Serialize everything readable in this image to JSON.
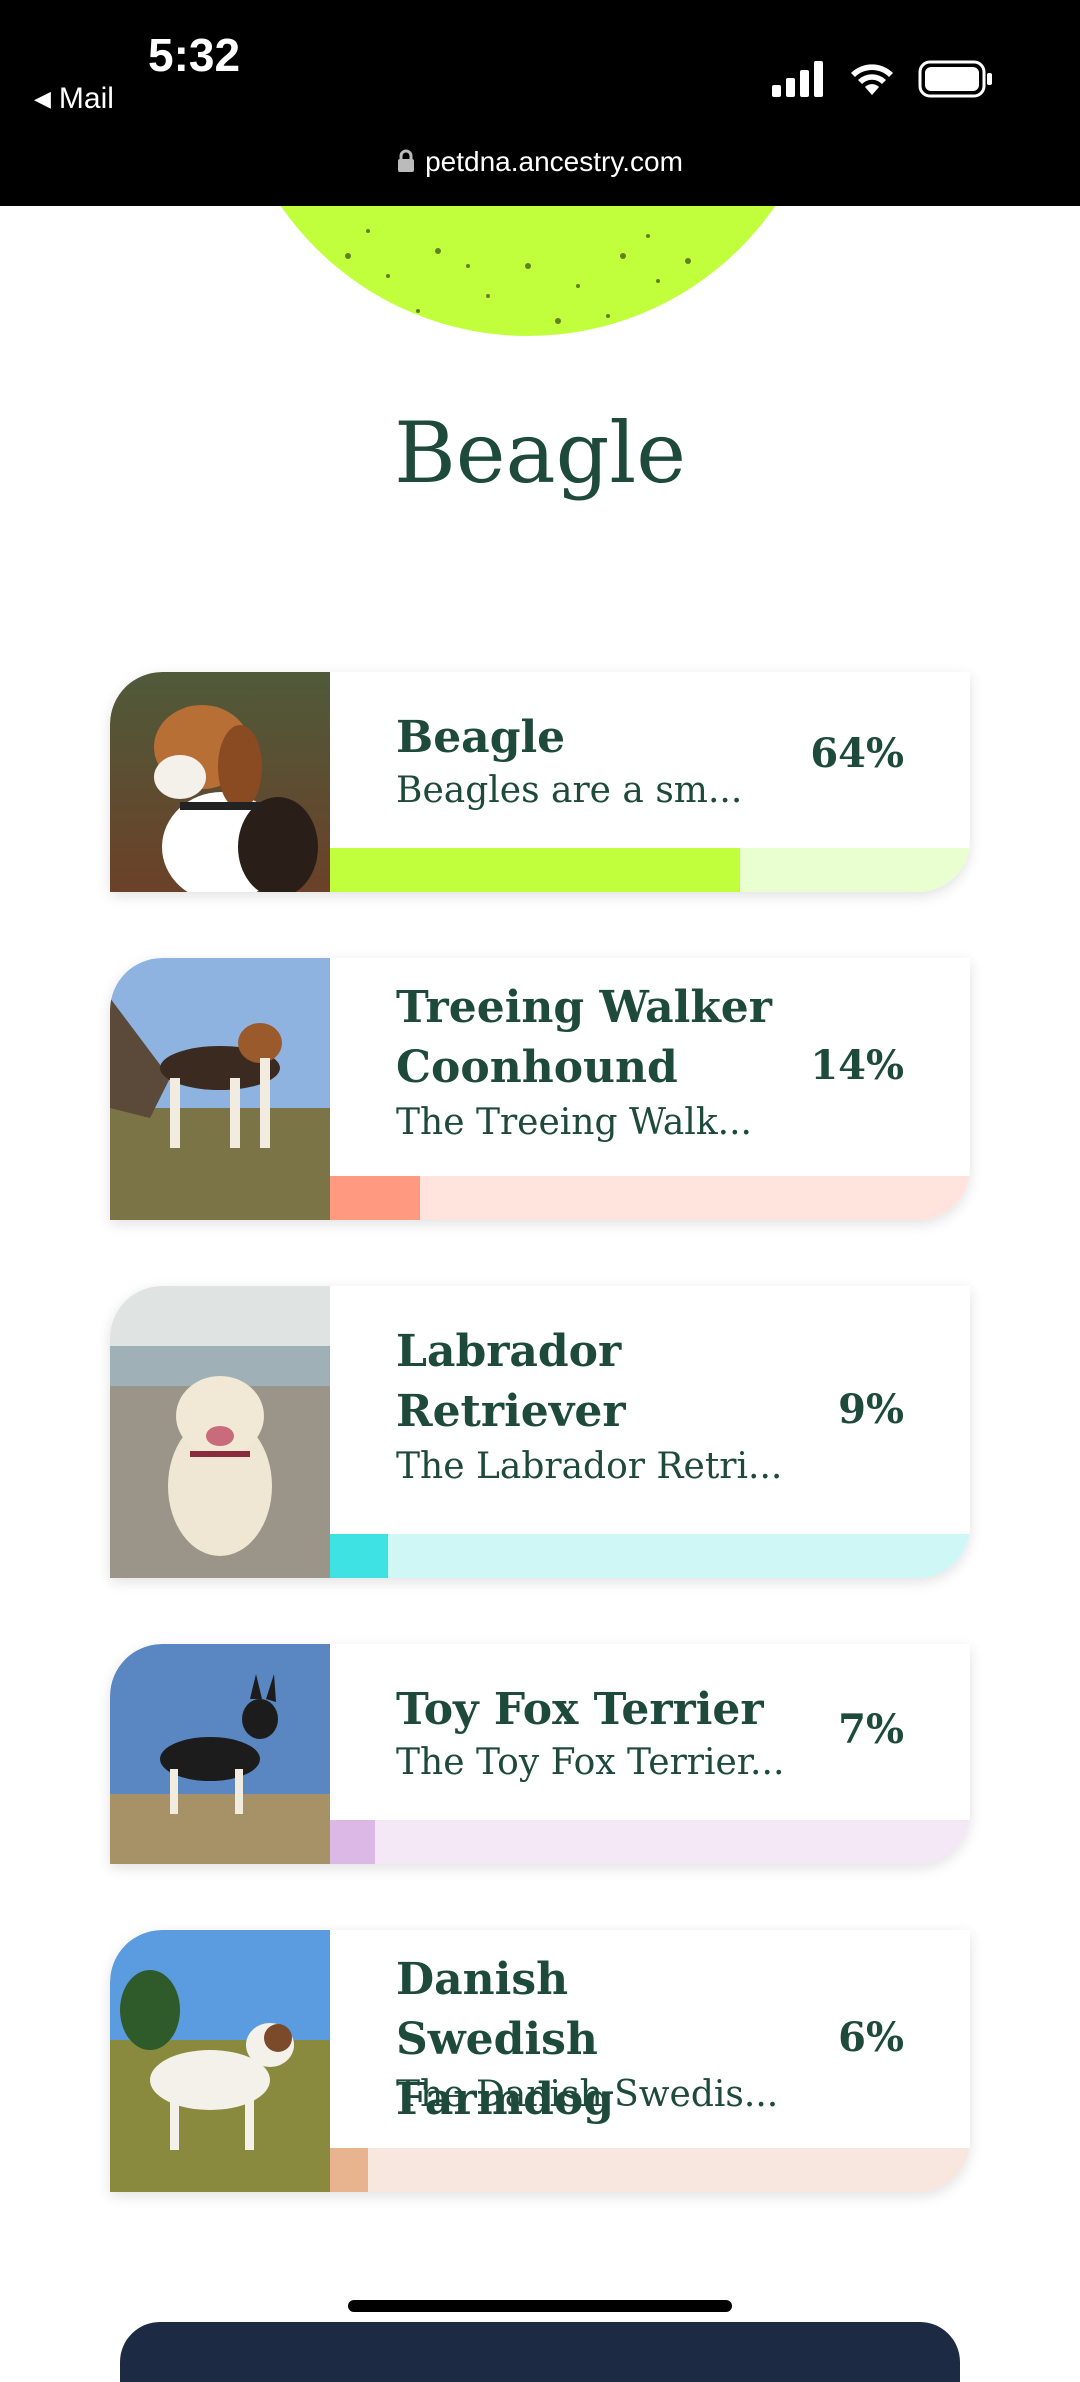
{
  "status_bar": {
    "time": "5:32",
    "back_app": "Mail",
    "url": "petdna.ancestry.com"
  },
  "page": {
    "title": "Beagle",
    "hero_color": "#c1ff3d"
  },
  "breeds": [
    {
      "name": "Beagle",
      "description": "Beagles are a sm...",
      "percent": "64%",
      "bar_fraction": 0.64,
      "bar_color": "#c1ff3d",
      "track_color": "#eaffd0"
    },
    {
      "name": "Treeing Walker Coonhound",
      "description": "The Treeing Walk...",
      "percent": "14%",
      "bar_fraction": 0.14,
      "bar_color": "#ff9a80",
      "track_color": "#ffe3dc"
    },
    {
      "name": "Labrador Retriever",
      "description": "The Labrador Retri...",
      "percent": "9%",
      "bar_fraction": 0.09,
      "bar_color": "#3ee2e2",
      "track_color": "#cff7f6"
    },
    {
      "name": "Toy Fox Terrier",
      "description": "The Toy Fox Terrier...",
      "percent": "7%",
      "bar_fraction": 0.07,
      "bar_color": "#dcb8e6",
      "track_color": "#f4e7f6"
    },
    {
      "name": "Danish Swedish Farmdog",
      "description": "The Danish Swedis...",
      "percent": "6%",
      "bar_fraction": 0.06,
      "bar_color": "#e8b38f",
      "track_color": "#f7e7de"
    }
  ]
}
